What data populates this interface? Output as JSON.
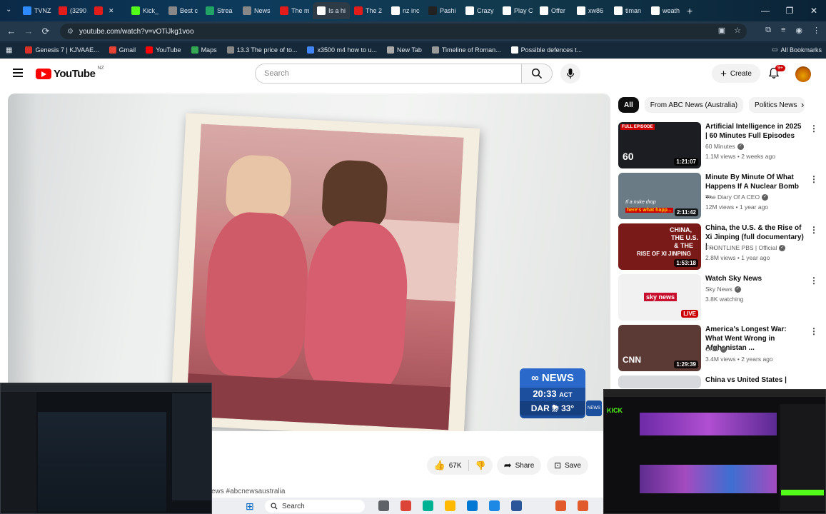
{
  "browser": {
    "tabs": [
      {
        "label": "TVNZ",
        "fav": "#2d8bff"
      },
      {
        "label": "(3290",
        "fav": "#e21b1b"
      },
      {
        "label": "",
        "fav": "#e21b1b"
      },
      {
        "label": "Kick_",
        "fav": "#53fc18"
      },
      {
        "label": "Best c",
        "fav": "#888888"
      },
      {
        "label": "Strea",
        "fav": "#21a366"
      },
      {
        "label": "News",
        "fav": "#888888"
      },
      {
        "label": "The m",
        "fav": "#e21b1b"
      },
      {
        "label": "Is a hi",
        "fav": "#ffffff"
      },
      {
        "label": "The 2",
        "fav": "#e21b1b"
      },
      {
        "label": "nz inc",
        "fav": "#ffffff"
      },
      {
        "label": "Pashi",
        "fav": "#222222"
      },
      {
        "label": "Crazy",
        "fav": "#ffffff"
      },
      {
        "label": "Play C",
        "fav": "#ffffff"
      },
      {
        "label": "Offer",
        "fav": "#ffffff"
      },
      {
        "label": "xw86",
        "fav": "#ffffff"
      },
      {
        "label": "timan",
        "fav": "#ffffff"
      },
      {
        "label": "weath",
        "fav": "#ffffff"
      }
    ],
    "url": "youtube.com/watch?v=vOTiJkg1voo",
    "bookmarks": [
      "Genesis 7 | KJVAAE...",
      "Gmail",
      "YouTube",
      "Maps",
      "13.3 The price of to...",
      "x3500 m4 how to u...",
      "New Tab",
      "Timeline of Roman...",
      "Possible defences t..."
    ],
    "all_bookmarks": "All Bookmarks"
  },
  "youtube": {
    "logo_text": "YouTube",
    "country": "NZ",
    "search_placeholder": "Search",
    "create_label": "Create",
    "notif_count": "9+",
    "chips": [
      "All",
      "From ABC News (Australia)",
      "Politics News"
    ],
    "recommendations": [
      {
        "title": "Artificial Intelligence in 2025 | 60 Minutes Full Episodes",
        "channel": "60 Minutes",
        "meta": "1.1M views • 2 weeks ago",
        "duration": "1:21:07",
        "tag": "FULL EPISODE",
        "bg": "#1b1d22",
        "kebab": "⋮"
      },
      {
        "title": "Minute By Minute Of What Happens If A Nuclear Bomb ...",
        "channel": "The Diary Of A CEO",
        "meta": "12M views • 1 year ago",
        "duration": "2:11:42",
        "tag": "",
        "bg": "#6b7b86",
        "kebab": "⋮"
      },
      {
        "title": "China, the U.S. & the Rise of Xi Jinping (full documentary) | ...",
        "channel": "FRONTLINE PBS | Official",
        "meta": "2.8M views • 1 year ago",
        "duration": "1:53:18",
        "tag": "",
        "bg": "#7a1a18",
        "kebab": "⋮"
      },
      {
        "title": "Watch Sky News",
        "channel": "Sky News",
        "meta": "3.8K watching",
        "duration": "LIVE",
        "tag": "",
        "bg": "#f1f1f1",
        "kebab": "⋮"
      },
      {
        "title": "America's Longest War: What Went Wrong in Afghanistan ...",
        "channel": "CNN",
        "meta": "3.4M views • 2 years ago",
        "duration": "1:29:39",
        "tag": "",
        "bg": "#5b3a35",
        "kebab": "⋮"
      },
      {
        "title": "China vs United States | Behind",
        "channel": "",
        "meta": "",
        "duration": "",
        "tag": "",
        "bg": "#d7d9dc",
        "kebab": ""
      }
    ],
    "thumb_texts": {
      "t1": "60",
      "t2a": "If a nuke drop",
      "t2b": "here's what happ...",
      "t3a": "CHINA,",
      "t3b": "THE U.S.",
      "t3c": "& THE",
      "t3d": "RISE OF XI JINPING",
      "t4": "sky news",
      "t5": "CNN"
    },
    "actions": {
      "likes": "67K",
      "share": "Share",
      "save": "Save"
    },
    "caption": "ews #abcnewsaustralia"
  },
  "video_overlay": {
    "brand": "NEWS",
    "time": "20:33",
    "tz": "ACT",
    "location": "DAR",
    "temp": "33°",
    "small_mark": "NEWS"
  },
  "taskbar": {
    "search_label": "Search"
  }
}
